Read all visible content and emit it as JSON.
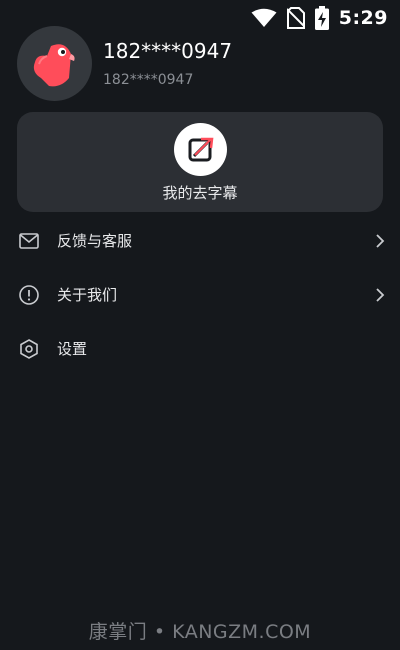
{
  "status_bar": {
    "time": "5:29",
    "icons": [
      "wifi-icon",
      "no-sim-icon",
      "battery-charging-icon"
    ]
  },
  "profile": {
    "avatar_icon": "parrot-avatar-icon",
    "username": "182****0947",
    "account_id": "182****0947"
  },
  "card": {
    "icon": "remove-subtitle-icon",
    "label": "我的去字幕"
  },
  "menu": {
    "items": [
      {
        "label": "反馈与客服",
        "icon": "mail-icon",
        "has_chevron": true
      },
      {
        "label": "关于我们",
        "icon": "info-icon",
        "has_chevron": true
      },
      {
        "label": "设置",
        "icon": "settings-hexagon-icon",
        "has_chevron": false
      }
    ]
  },
  "watermark": "康掌门 • KANGZM.COM",
  "colors": {
    "background": "#15181c",
    "card": "#2c2f34",
    "avatar_bg": "#34383d",
    "accent_red": "#ff4d5a",
    "text_secondary": "#8b8f95"
  }
}
